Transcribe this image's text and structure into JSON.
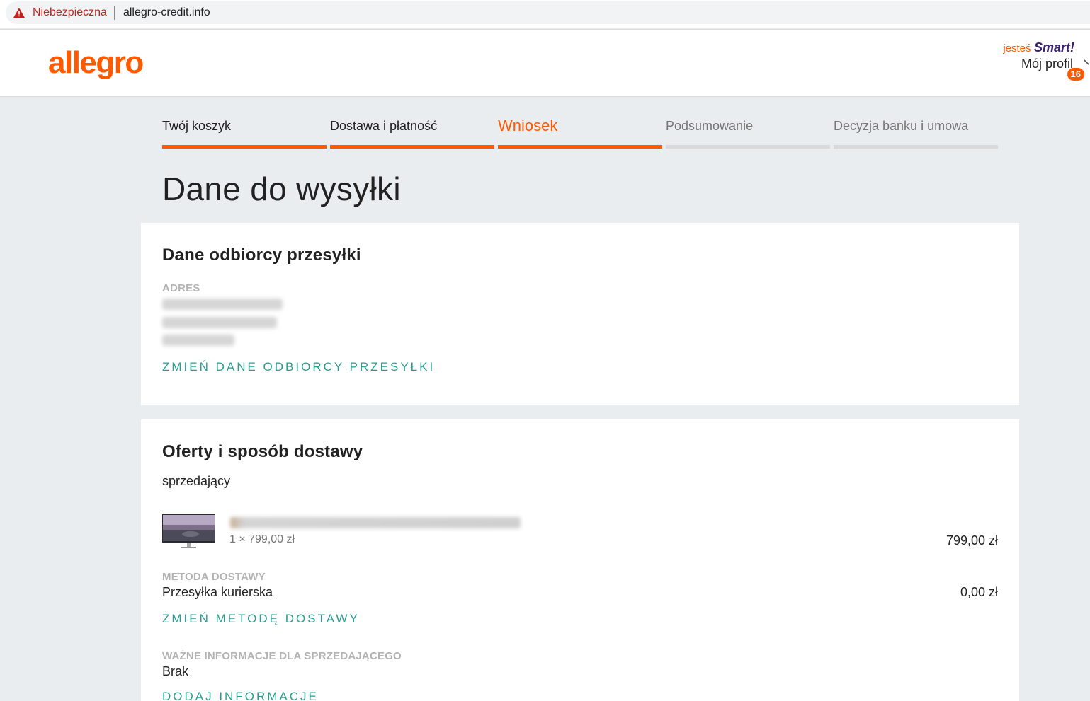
{
  "browser": {
    "security_label": "Niebezpieczna",
    "url": "allegro-credit.info"
  },
  "header": {
    "logo": "allegro",
    "smart_prefix": "jesteś",
    "smart_label": "Smart!",
    "profile_label": "Mój profil",
    "notification_count": "16",
    "brand_color": "#ff5a00"
  },
  "steps": [
    {
      "label": "Twój koszyk",
      "state": "done"
    },
    {
      "label": "Dostawa i płatność",
      "state": "done"
    },
    {
      "label": "Wniosek",
      "state": "active"
    },
    {
      "label": "Podsumowanie",
      "state": "todo"
    },
    {
      "label": "Decyzja banku i umowa",
      "state": "todo"
    }
  ],
  "page_title": "Dane do wysyłki",
  "recipient": {
    "title": "Dane odbiorcy przesyłki",
    "address_caption": "ADRES",
    "change_link": "ZMIEŃ DANE ODBIORCY PRZESYŁKI"
  },
  "offers": {
    "title": "Oferty i sposób dostawy",
    "seller_label": "sprzedający",
    "item": {
      "quantity_price": "1 × 799,00 zł",
      "total": "799,00 zł"
    },
    "delivery_caption": "METODA DOSTAWY",
    "delivery_method": "Przesyłka kurierska",
    "delivery_price": "0,00 zł",
    "change_delivery_link": "ZMIEŃ METODĘ DOSTAWY",
    "info_caption": "WAŻNE INFORMACJE DLA SPRZEDAJĄCEGO",
    "info_value": "Brak",
    "add_info_link": "DODAJ INFORMACJE"
  },
  "link_color": "#2a9d8f"
}
